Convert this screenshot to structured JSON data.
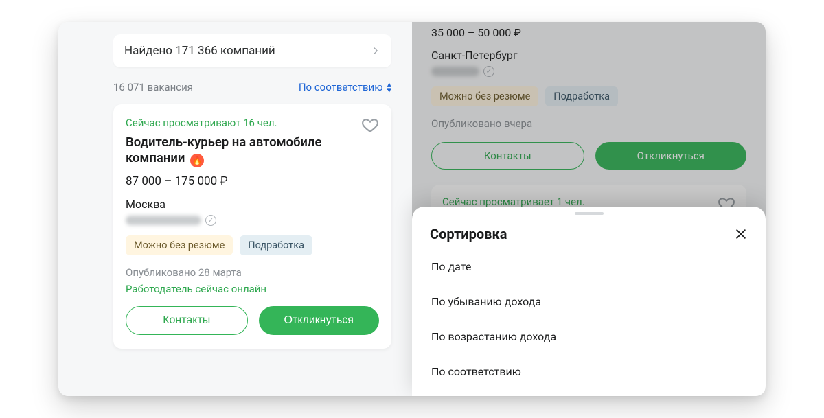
{
  "left": {
    "companies_bar": "Найдено 171 366 компаний",
    "vacancies_count": "16 071 вакансия",
    "sort_label": "По соответствию",
    "card": {
      "viewers": "Сейчас просматривают 16 чел.",
      "title": "Водитель-курьер на автомобиле компании",
      "salary": "87 000 – 175 000 ₽",
      "city": "Москва",
      "tag_no_resume": "Можно без резюме",
      "tag_parttime": "Подработка",
      "published": "Опубликовано 28 марта",
      "employer_online": "Работодатель сейчас онлайн",
      "btn_contacts": "Контакты",
      "btn_apply": "Откликнуться"
    }
  },
  "right_bg": {
    "salary": "35 000 – 50 000 ₽",
    "city": "Санкт-Петербург",
    "tag_no_resume": "Можно без резюме",
    "tag_parttime": "Подработка",
    "published": "Опубликовано вчера",
    "btn_contacts": "Контакты",
    "btn_apply": "Откликнуться",
    "card2_viewers": "Сейчас просматривает 1 чел."
  },
  "sheet": {
    "title": "Сортировка",
    "options": {
      "by_date": "По дате",
      "salary_desc": "По убыванию дохода",
      "salary_asc": "По возрастанию дохода",
      "relevance": "По соответствию"
    }
  }
}
